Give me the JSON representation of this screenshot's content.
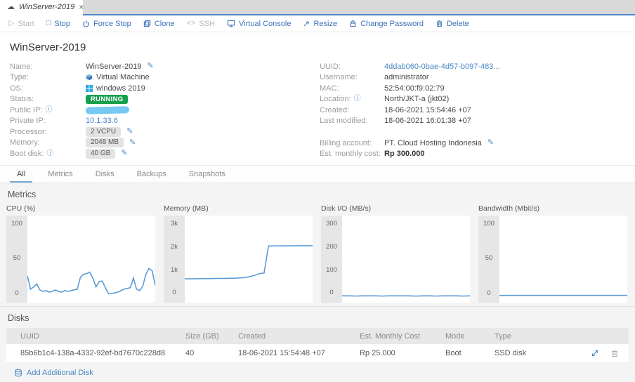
{
  "colors": {
    "accent": "#3b72b8",
    "link": "#4c88c8",
    "chart_line": "#5b9bd5",
    "running_green": "#17a04c",
    "redaction_blue": "#76c9f1"
  },
  "icons": {
    "tab_cloud": "☁",
    "close": "×",
    "start_glyph": "▷",
    "stop_glyph": "□",
    "ssh_glyph": "<>",
    "edit_pencil": "✎",
    "info": "ⓘ"
  },
  "tab_bar": {
    "title": "WinServer-2019"
  },
  "toolbar": {
    "items": [
      {
        "label": "Start",
        "enabled": false
      },
      {
        "label": "Stop",
        "enabled": true
      },
      {
        "label": "Force Stop",
        "enabled": true
      },
      {
        "label": "Clone",
        "enabled": true
      },
      {
        "label": "SSH",
        "enabled": false
      },
      {
        "label": "Virtual Console",
        "enabled": true
      },
      {
        "label": "Resize",
        "enabled": true
      },
      {
        "label": "Change Password",
        "enabled": true
      },
      {
        "label": "Delete",
        "enabled": true
      }
    ]
  },
  "details": {
    "title": "WinServer-2019",
    "name_label": "Name:",
    "name_value": "WinServer-2019",
    "type_label": "Type:",
    "type_value": "Virtual Machine",
    "os_label": "OS:",
    "os_value": "windows 2019",
    "status_label": "Status:",
    "status_value": "RUNNING",
    "public_ip_label": "Public IP:",
    "private_ip_label": "Private IP:",
    "private_ip_value": "10.1.33.6",
    "processor_label": "Processor:",
    "processor_value": "2 VCPU",
    "memory_label": "Memory:",
    "memory_value": "2048 MB",
    "boot_disk_label": "Boot disk:",
    "boot_disk_value": "40 GB",
    "uuid_label": "UUID:",
    "uuid_value": "4ddab060-0bae-4d57-b097-483...",
    "username_label": "Username:",
    "username_value": "administrator",
    "mac_label": "MAC:",
    "mac_value": "52:54:00:f9:02:79",
    "location_label": "Location:",
    "location_value": "North/JKT-a (jkt02)",
    "created_label": "Created:",
    "created_value": "18-06-2021 15:54:46 +07",
    "last_modified_label": "Last modified:",
    "last_modified_value": "18-06-2021 16:01:38 +07",
    "billing_account_label": "Billing account:",
    "billing_account_value": "PT. Cloud Hosting Indonesia",
    "est_monthly_cost_label": "Est. monthly cost:",
    "est_monthly_cost_value": "Rp 300.000"
  },
  "tabs": {
    "items": [
      "All",
      "Metrics",
      "Disks",
      "Backups",
      "Snapshots"
    ],
    "active": "All"
  },
  "sections": {
    "metrics_heading": "Metrics",
    "disks_heading": "Disks"
  },
  "chart_data": [
    {
      "type": "line",
      "title": "CPU (%)",
      "ylim": [
        0,
        100
      ],
      "yticks": [
        "100",
        "50",
        "0"
      ],
      "grid": false,
      "legend": "none",
      "values": [
        28,
        10,
        13,
        17,
        9,
        7,
        8,
        6,
        7,
        9,
        7,
        6,
        8,
        7,
        8,
        9,
        10,
        26,
        30,
        31,
        33,
        25,
        13,
        20,
        21,
        12,
        4,
        4,
        5,
        6,
        8,
        10,
        11,
        12,
        25,
        10,
        8,
        14,
        30,
        38,
        35,
        15
      ]
    },
    {
      "type": "line",
      "title": "Memory (MB)",
      "ylim": [
        0,
        3000
      ],
      "yticks": [
        "3k",
        "2k",
        "1k",
        "0"
      ],
      "grid": false,
      "legend": "none",
      "values": [
        720,
        718,
        720,
        722,
        725,
        728,
        730,
        732,
        735,
        738,
        740,
        745,
        750,
        760,
        780,
        820,
        870,
        930,
        955,
        2050,
        2052,
        2055,
        2056,
        2058,
        2058,
        2059,
        2060,
        2060,
        2060,
        2060
      ]
    },
    {
      "type": "line",
      "title": "Disk I/O (MB/s)",
      "ylim": [
        0,
        300
      ],
      "yticks": [
        "300",
        "200",
        "100",
        "0"
      ],
      "grid": false,
      "legend": "none",
      "values": [
        3,
        3,
        2,
        3,
        3,
        3,
        2,
        3,
        3,
        3,
        3,
        2,
        3,
        3,
        2,
        3,
        3,
        3,
        2,
        3
      ]
    },
    {
      "type": "line",
      "title": "Bandwidth (Mbit/s)",
      "ylim": [
        0,
        100
      ],
      "yticks": [
        "100",
        "50",
        "0"
      ],
      "grid": false,
      "legend": "none",
      "values": [
        1.5,
        1.5,
        1.5,
        1.5,
        1.5,
        1.5,
        1.5,
        1.5,
        1.5,
        1.5,
        1.5,
        1.5,
        1.5,
        1.5,
        1.5,
        1.5,
        1.5,
        1.5,
        1.5,
        1.5
      ]
    }
  ],
  "disks": {
    "columns": [
      "UUID",
      "Size (GB)",
      "Created",
      "Est. Monthly Cost",
      "Mode",
      "Type"
    ],
    "rows": [
      [
        "85b6b1c4-138a-4332-92ef-bd7670c228d8",
        "40",
        "18-06-2021 15:54:48 +07",
        "Rp 25.000",
        "Boot",
        "SSD disk"
      ]
    ],
    "add_label": "Add Additional Disk"
  }
}
